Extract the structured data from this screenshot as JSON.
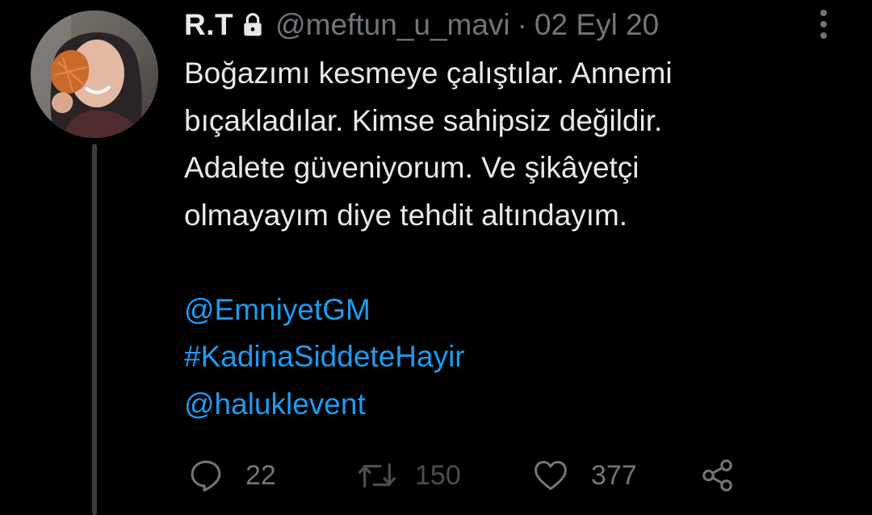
{
  "tweet": {
    "author": {
      "display_name": "R.T",
      "locked": true,
      "lock_icon": "lock-icon",
      "handle": "@meftun_u_mavi",
      "separator": "·",
      "date": "02 Eyl 20"
    },
    "text_lines": [
      "Boğazımı kesmeye çalıştılar. Annemi",
      "bıçakladılar. Kimse sahipsiz değildir.",
      "Adalete güveniyorum. Ve şikâyetçi",
      "olmayayım diye tehdit altındayım."
    ],
    "links": [
      "@EmniyetGM",
      "#KadinaSiddeteHayir",
      "@haluklevent"
    ],
    "actions": {
      "reply": {
        "icon": "reply-icon",
        "count": "22"
      },
      "retweet": {
        "icon": "retweet-icon",
        "count": "150",
        "disabled": true
      },
      "like": {
        "icon": "heart-icon",
        "count": "377"
      },
      "share": {
        "icon": "share-icon"
      }
    },
    "more_icon": "more-vertical-icon"
  },
  "colors": {
    "background": "#000000",
    "text": "#e7e9ea",
    "muted": "#71767b",
    "link": "#1d9bf0",
    "thread_line": "#3a3c3f"
  }
}
